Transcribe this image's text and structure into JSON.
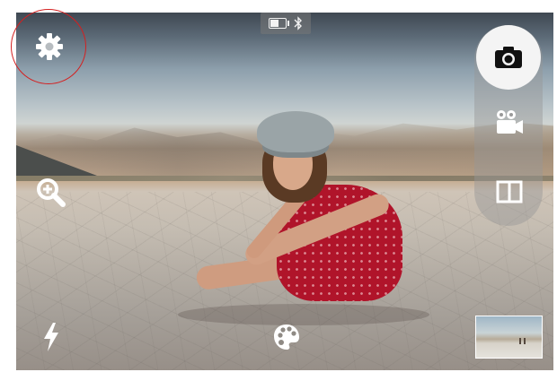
{
  "app": {
    "screen": "camera-viewfinder"
  },
  "status_bar": {
    "battery_level": 0.6,
    "icons": [
      "battery-icon",
      "bluetooth-icon"
    ]
  },
  "controls": {
    "settings": {
      "icon": "gear-icon",
      "highlight_color": "#d42020"
    },
    "zoom": {
      "icon": "zoom-in-icon"
    },
    "flash": {
      "icon": "flash-icon"
    },
    "filters": {
      "icon": "palette-icon"
    }
  },
  "mode_rail": {
    "modes": [
      {
        "id": "photo",
        "icon": "camera-icon",
        "selected": true
      },
      {
        "id": "video",
        "icon": "video-camera-icon",
        "selected": false
      },
      {
        "id": "split",
        "icon": "split-view-icon",
        "selected": false
      }
    ]
  },
  "gallery": {
    "icon": "last-photo-thumbnail"
  },
  "colors": {
    "icon": "#ffffff",
    "shutter_bg": "#f4f4f4",
    "rail_bg": "rgba(150,150,150,0.45)",
    "highlight": "#d42020"
  }
}
